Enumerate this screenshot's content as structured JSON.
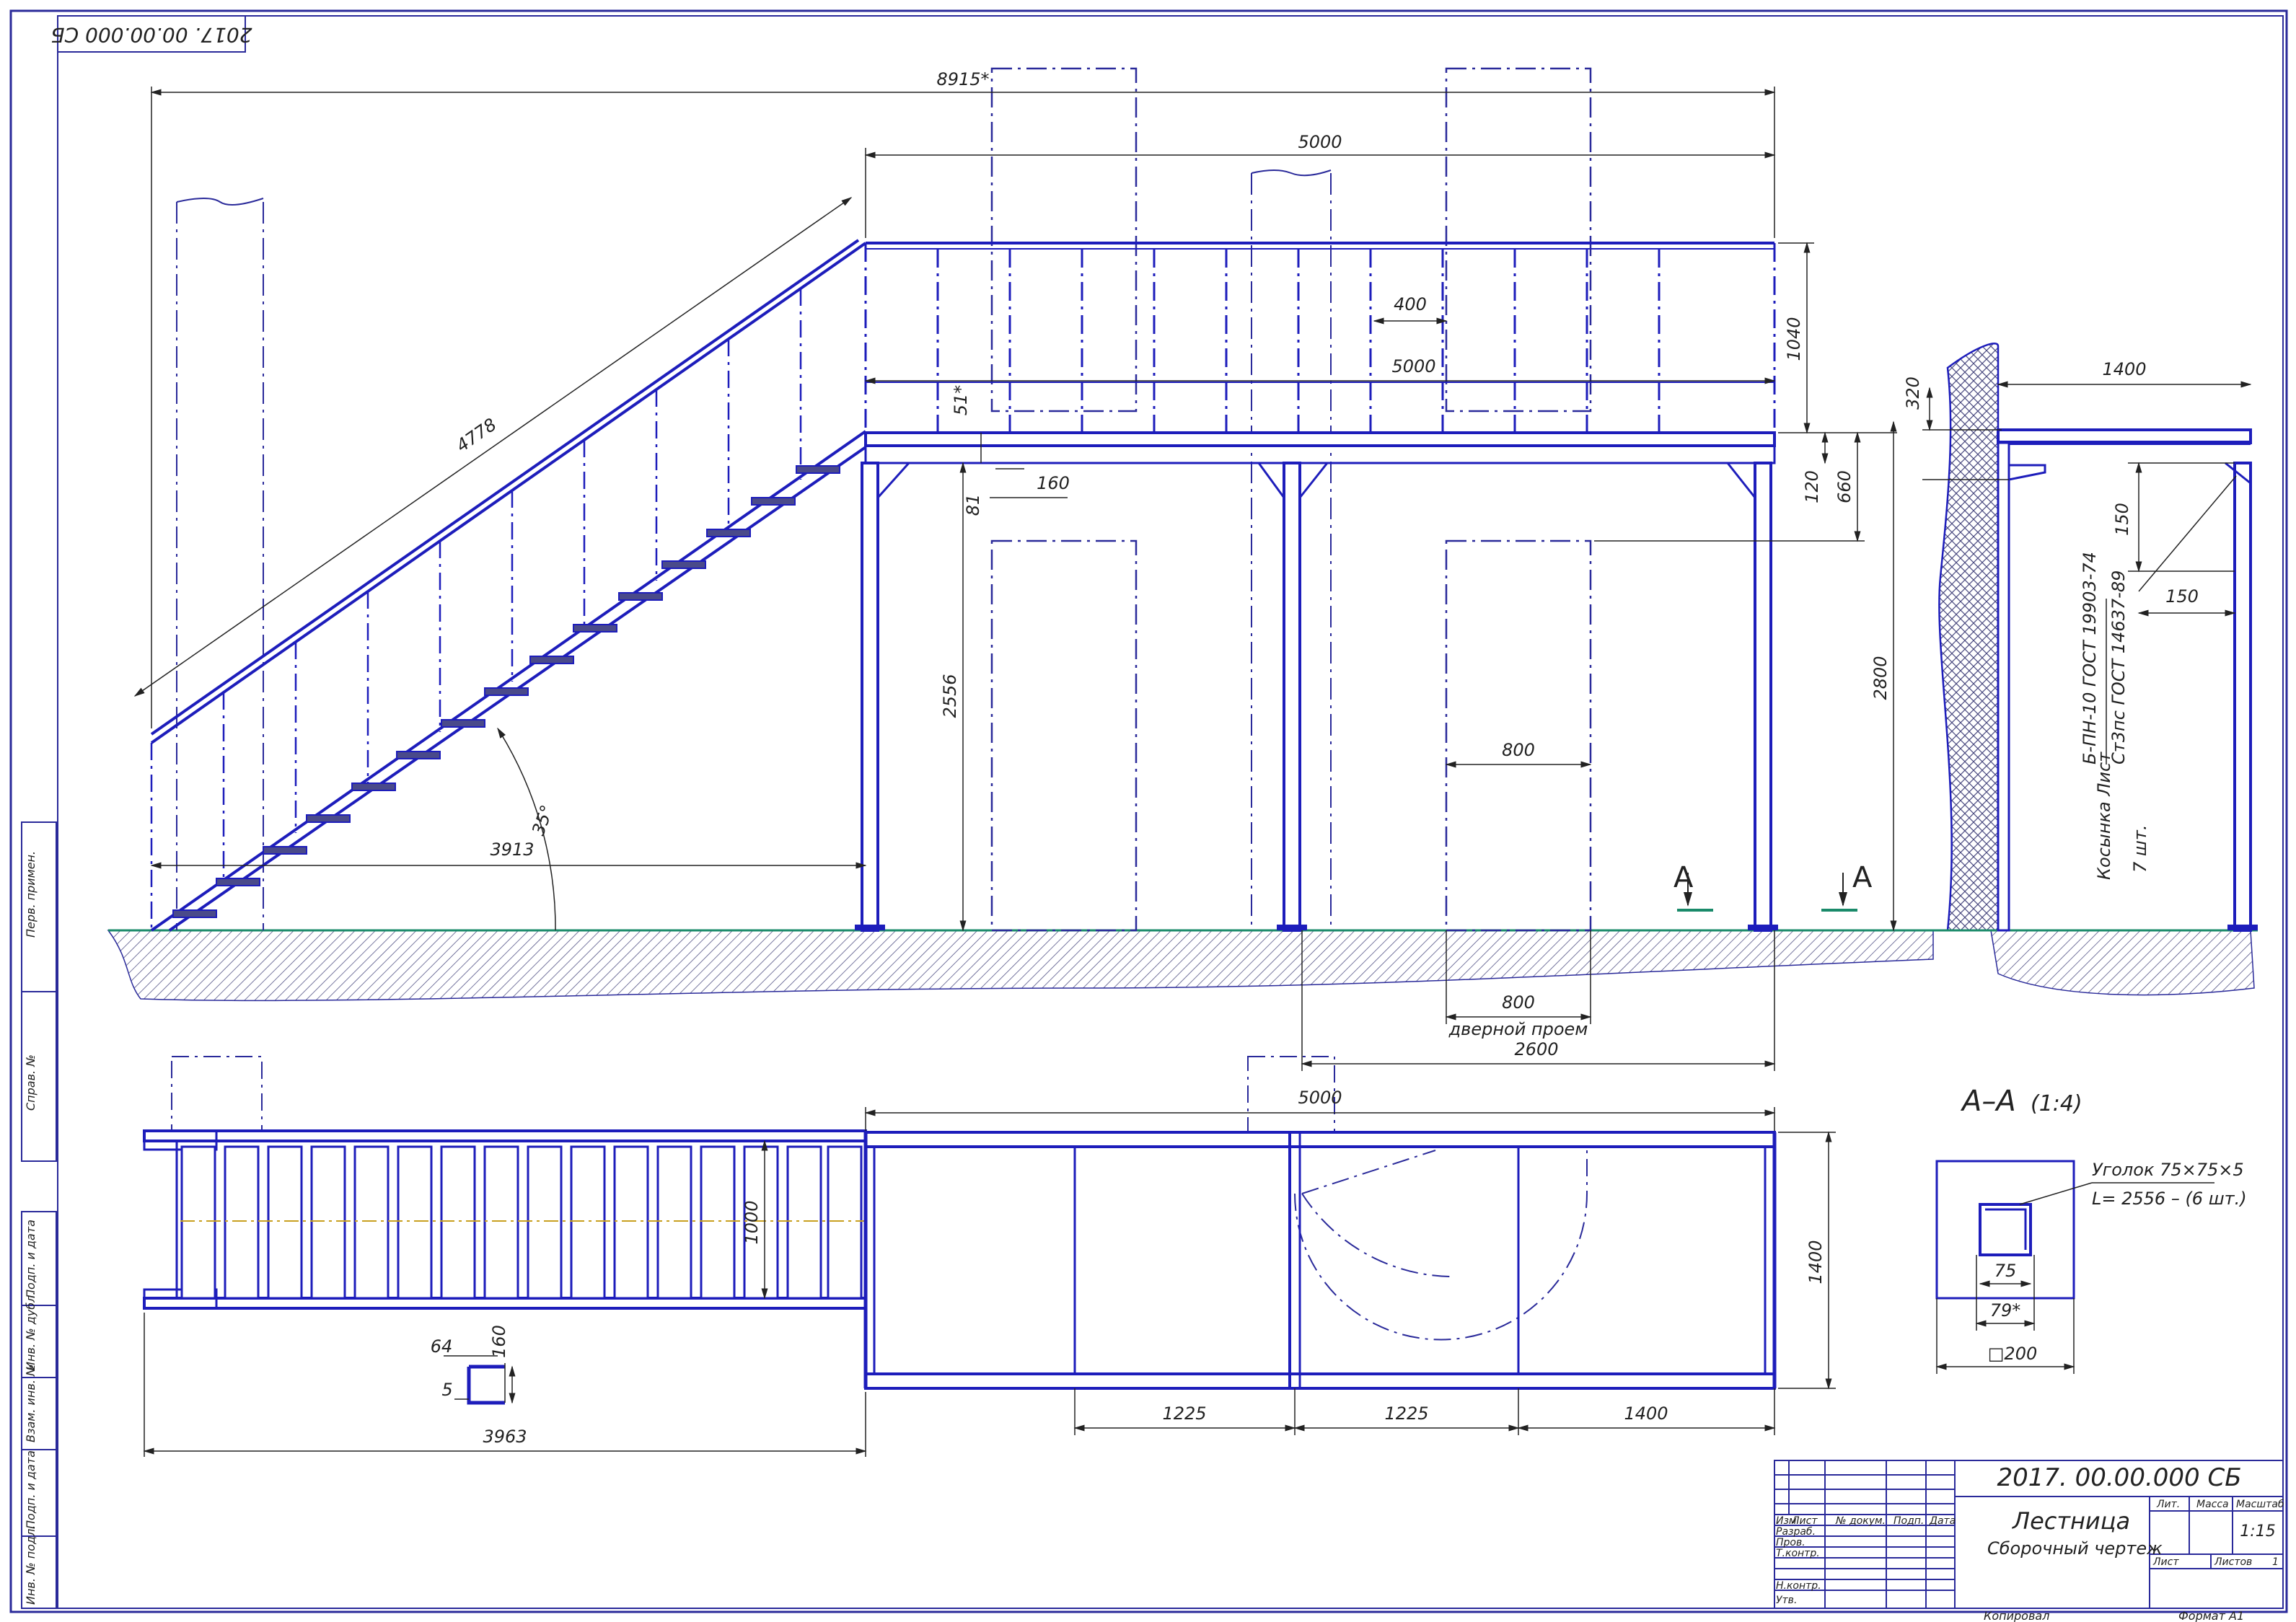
{
  "sheet": {
    "inverted_code": "2017. 00.00.000 СБ",
    "format": "Формат А1",
    "copied": "Копировал"
  },
  "dims": {
    "overall_len": "8915*",
    "top_len": "5000",
    "rail_len": "5000",
    "post_spacing": "400",
    "rail_height": "1040",
    "stair_len": "4778",
    "stair_angle": "35°",
    "stair_run": "3913",
    "col_height": "2556",
    "total_height": "2800",
    "deck_gap": "120",
    "beam_h": "660",
    "note_51": "51*",
    "note_81": "81",
    "note_160": "160",
    "door_w": "800",
    "door_w2": "800",
    "door_label": "дверной проем",
    "door_offset": "2600",
    "section_mark": "A",
    "plan_len": "5000",
    "plan_width": "1400",
    "step_width": "1000",
    "channel_w": "64",
    "channel_h": "160",
    "channel_t": "5",
    "plan_total": "3963",
    "bay1": "1225",
    "bay2": "1225",
    "bay3": "1400",
    "side_width": "1400",
    "side_320": "320",
    "side_150a": "150",
    "side_150b": "150",
    "side_note1": "Косынка Лист",
    "side_note1b": "Б-ПН-10 ГОСТ 19903-74",
    "side_note1c": "Ст3пс ГОСТ 14637-89",
    "side_note2": "7 шт."
  },
  "section": {
    "title": "А–А",
    "scale": "(1:4)",
    "note1": "Уголок 75×75×5",
    "note2": "L= 2556 – (6 шт.)",
    "dim75": "75",
    "dim79": "79*",
    "dim200": "□200"
  },
  "title_block": {
    "code": "2017. 00.00.000 СБ",
    "name": "Лестница",
    "subtitle": "Сборочный чертеж",
    "col_izm": "Изм",
    "col_list": "Лист",
    "col_doc": "№ докум.",
    "col_sign": "Подп.",
    "col_date": "Дата",
    "razrab": "Разраб.",
    "prov": "Пров.",
    "tkontr": "Т.контр.",
    "nkontr": "Н.контр.",
    "utv": "Утв.",
    "lit": "Лит.",
    "massa": "Масса",
    "masshtab": "Масштаб",
    "scale_value": "1:15",
    "list_label": "Лист",
    "listov_label": "Листов",
    "listov_value": "1"
  },
  "side_stamps": [
    "Перв. примен.",
    "Справ. №",
    "Подп. и дата",
    "Инв. № дубл.",
    "Взам. инв. №",
    "Подп. и дата",
    "Инв. № подл."
  ]
}
